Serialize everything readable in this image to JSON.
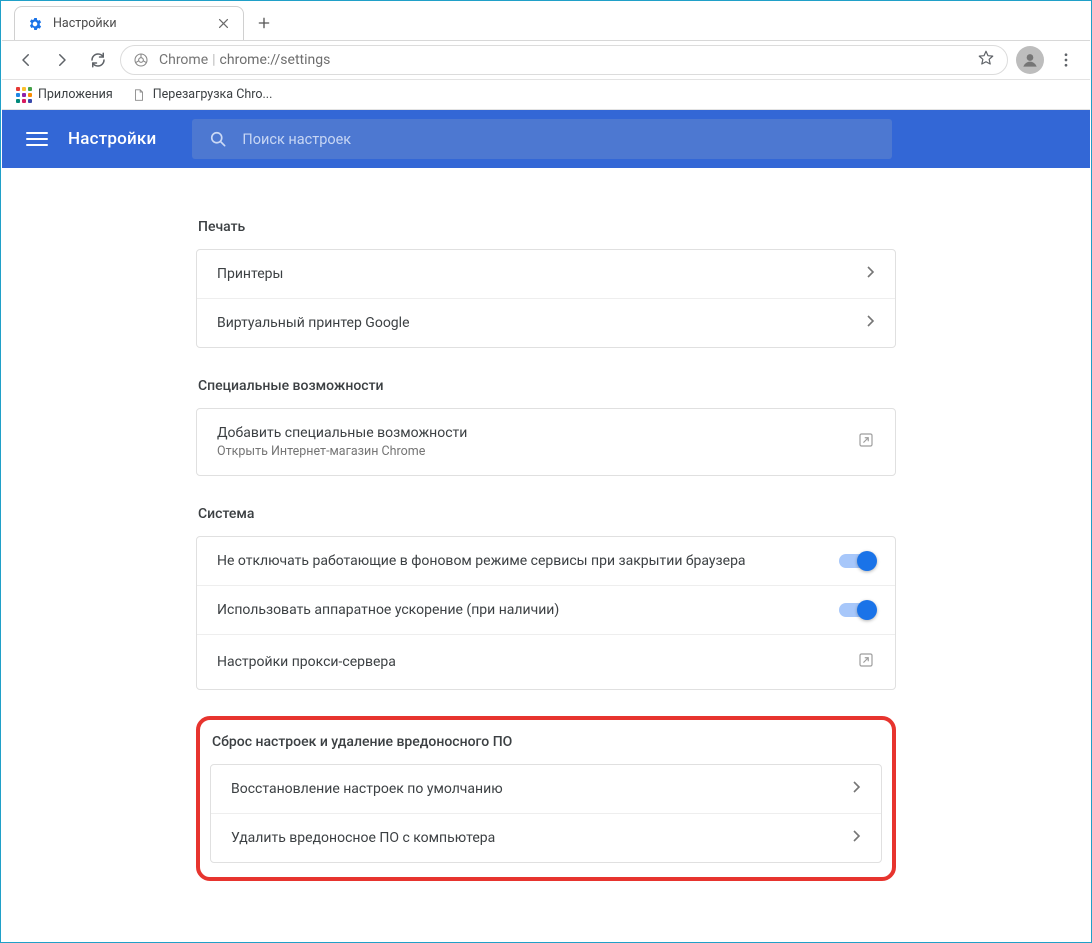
{
  "window": {
    "tab_title": "Настройки"
  },
  "toolbar": {
    "url_prefix": "Chrome",
    "url_path": "chrome://settings"
  },
  "bookmarks": {
    "apps": "Приложения",
    "item1": "Перезагрузка Chro..."
  },
  "app": {
    "title": "Настройки",
    "search_placeholder": "Поиск настроек"
  },
  "sections": {
    "print": {
      "title": "Печать",
      "rows": {
        "printers": "Принтеры",
        "cloud": "Виртуальный принтер Google"
      }
    },
    "a11y": {
      "title": "Специальные возможности",
      "rows": {
        "add_label": "Добавить специальные возможности",
        "add_sub": "Открыть Интернет-магазин Chrome"
      }
    },
    "system": {
      "title": "Система",
      "rows": {
        "bg": "Не отключать работающие в фоновом режиме сервисы при закрытии браузера",
        "hw": "Использовать аппаратное ускорение (при наличии)",
        "proxy": "Настройки прокси-сервера"
      }
    },
    "reset": {
      "title": "Сброс настроек и удаление вредоносного ПО",
      "rows": {
        "restore": "Восстановление настроек по умолчанию",
        "cleanup": "Удалить вредоносное ПО с компьютера"
      }
    }
  }
}
